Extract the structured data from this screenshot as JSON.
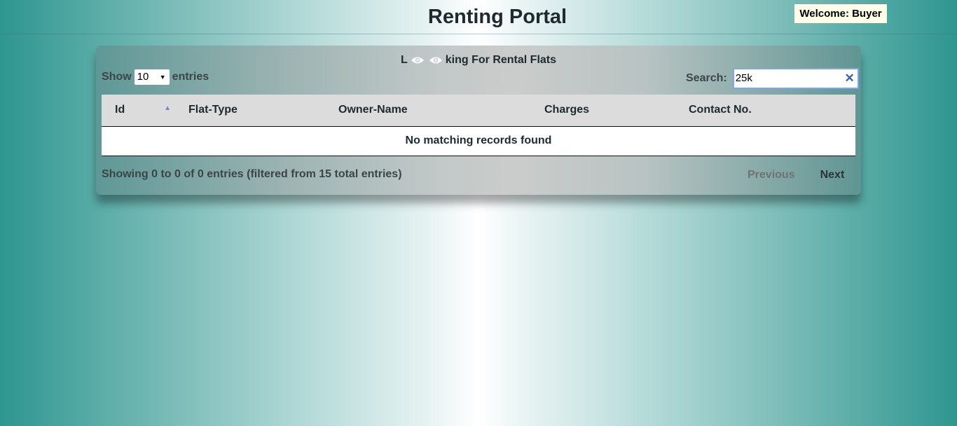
{
  "header": {
    "title": "Renting Portal",
    "welcome": "Welcome: Buyer"
  },
  "panel": {
    "title_before": "L",
    "title_icons": [
      "eye-icon",
      "eye-icon"
    ],
    "title_after": "king For Rental Flats",
    "length": {
      "prefix": "Show",
      "value": "10",
      "suffix": "entries"
    },
    "search": {
      "label": "Search:",
      "value": "25k"
    },
    "table": {
      "columns": [
        "Id",
        "Flat-Type",
        "Owner-Name",
        "Charges",
        "Contact No."
      ],
      "sorted_column": "Id",
      "sort_direction": "ascending",
      "empty_message": "No matching records found"
    },
    "info": "Showing 0 to 0 of 0 entries (filtered from 15 total entries)",
    "pagination": {
      "previous": "Previous",
      "next": "Next"
    }
  },
  "colors": {
    "accent_teal": "#2e9690",
    "search_border": "#7fa7e6",
    "sort_icon": "#8080d8"
  }
}
